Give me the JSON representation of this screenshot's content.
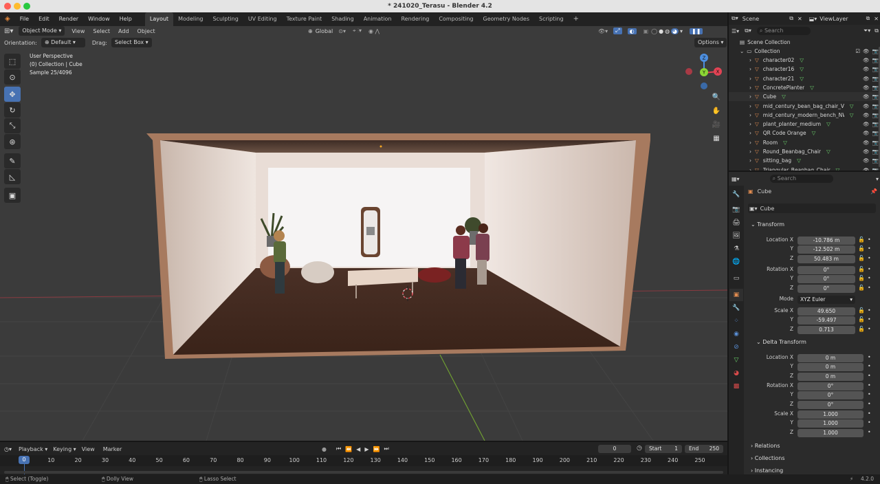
{
  "window": {
    "title": "* 241020_Terasu - Blender 4.2"
  },
  "menu": {
    "items": [
      "File",
      "Edit",
      "Render",
      "Window",
      "Help"
    ]
  },
  "workspaces": {
    "active": "Layout",
    "tabs": [
      "Layout",
      "Modeling",
      "Sculpting",
      "UV Editing",
      "Texture Paint",
      "Shading",
      "Animation",
      "Rendering",
      "Compositing",
      "Geometry Nodes",
      "Scripting"
    ]
  },
  "topright": {
    "scene": "Scene",
    "view_layer": "ViewLayer"
  },
  "viewport": {
    "mode": "Object Mode",
    "menus": [
      "View",
      "Select",
      "Add",
      "Object"
    ],
    "transform_space": "Global",
    "orientation_label": "Orientation:",
    "orientation_value": "Default",
    "drag_label": "Drag:",
    "drag_value": "Select Box",
    "options_label": "Options",
    "info_line1": "User Perspective",
    "info_line2": "(0) Collection | Cube",
    "info_line3": "Sample 25/4096"
  },
  "gizmo": {
    "x": "X",
    "y": "Y",
    "z": "Z"
  },
  "outliner": {
    "search_placeholder": "Search",
    "root": "Scene Collection",
    "collection": "Collection",
    "items": [
      "character02",
      "character16",
      "character21",
      "ConcretePlanter",
      "Cube",
      "mid_century_bean_bag_chair_VM",
      "mid_century_modern_bench_NWI",
      "plant_planter_medium",
      "QR Code Orange",
      "Room",
      "Round_Beanbag_Chair",
      "sitting_bag",
      "Triangular_Beanbag_Chair"
    ]
  },
  "properties": {
    "search_placeholder": "Search",
    "object_name": "Cube",
    "data_name": "Cube",
    "transform_title": "Transform",
    "location_label": "Location X",
    "location": [
      "-10.786 m",
      "-12.502 m",
      "50.483 m"
    ],
    "rotation_label": "Rotation X",
    "rotation": [
      "0°",
      "0°",
      "0°"
    ],
    "mode_label": "Mode",
    "mode_value": "XYZ Euler",
    "scale_label": "Scale X",
    "scale": [
      "49.650",
      "-59.497",
      "0.713"
    ],
    "delta_title": "Delta Transform",
    "delta_location": [
      "0 m",
      "0 m",
      "0 m"
    ],
    "delta_rotation": [
      "0°",
      "0°",
      "0°"
    ],
    "delta_scale": [
      "1.000",
      "1.000",
      "1.000"
    ],
    "axis_y": "Y",
    "axis_z": "Z",
    "relations": "Relations",
    "collections": "Collections",
    "instancing": "Instancing"
  },
  "timeline": {
    "menus": [
      "Playback",
      "Keying",
      "View",
      "Marker"
    ],
    "current_frame": "0",
    "start_label": "Start",
    "start_value": "1",
    "end_label": "End",
    "end_value": "250",
    "ticks": [
      "0",
      "10",
      "20",
      "30",
      "40",
      "50",
      "60",
      "70",
      "80",
      "90",
      "100",
      "110",
      "120",
      "130",
      "140",
      "150",
      "160",
      "170",
      "180",
      "190",
      "200",
      "210",
      "220",
      "230",
      "240",
      "250"
    ]
  },
  "status": {
    "left": "Select (Toggle)",
    "middle": "Dolly View",
    "right": "Lasso Select",
    "version": "4.2.0"
  },
  "colors": {
    "accent": "#4772b3",
    "x_axis": "#e24354",
    "y_axis": "#8bd534",
    "z_axis": "#4d8fe0",
    "object_orange": "#e08c50"
  }
}
